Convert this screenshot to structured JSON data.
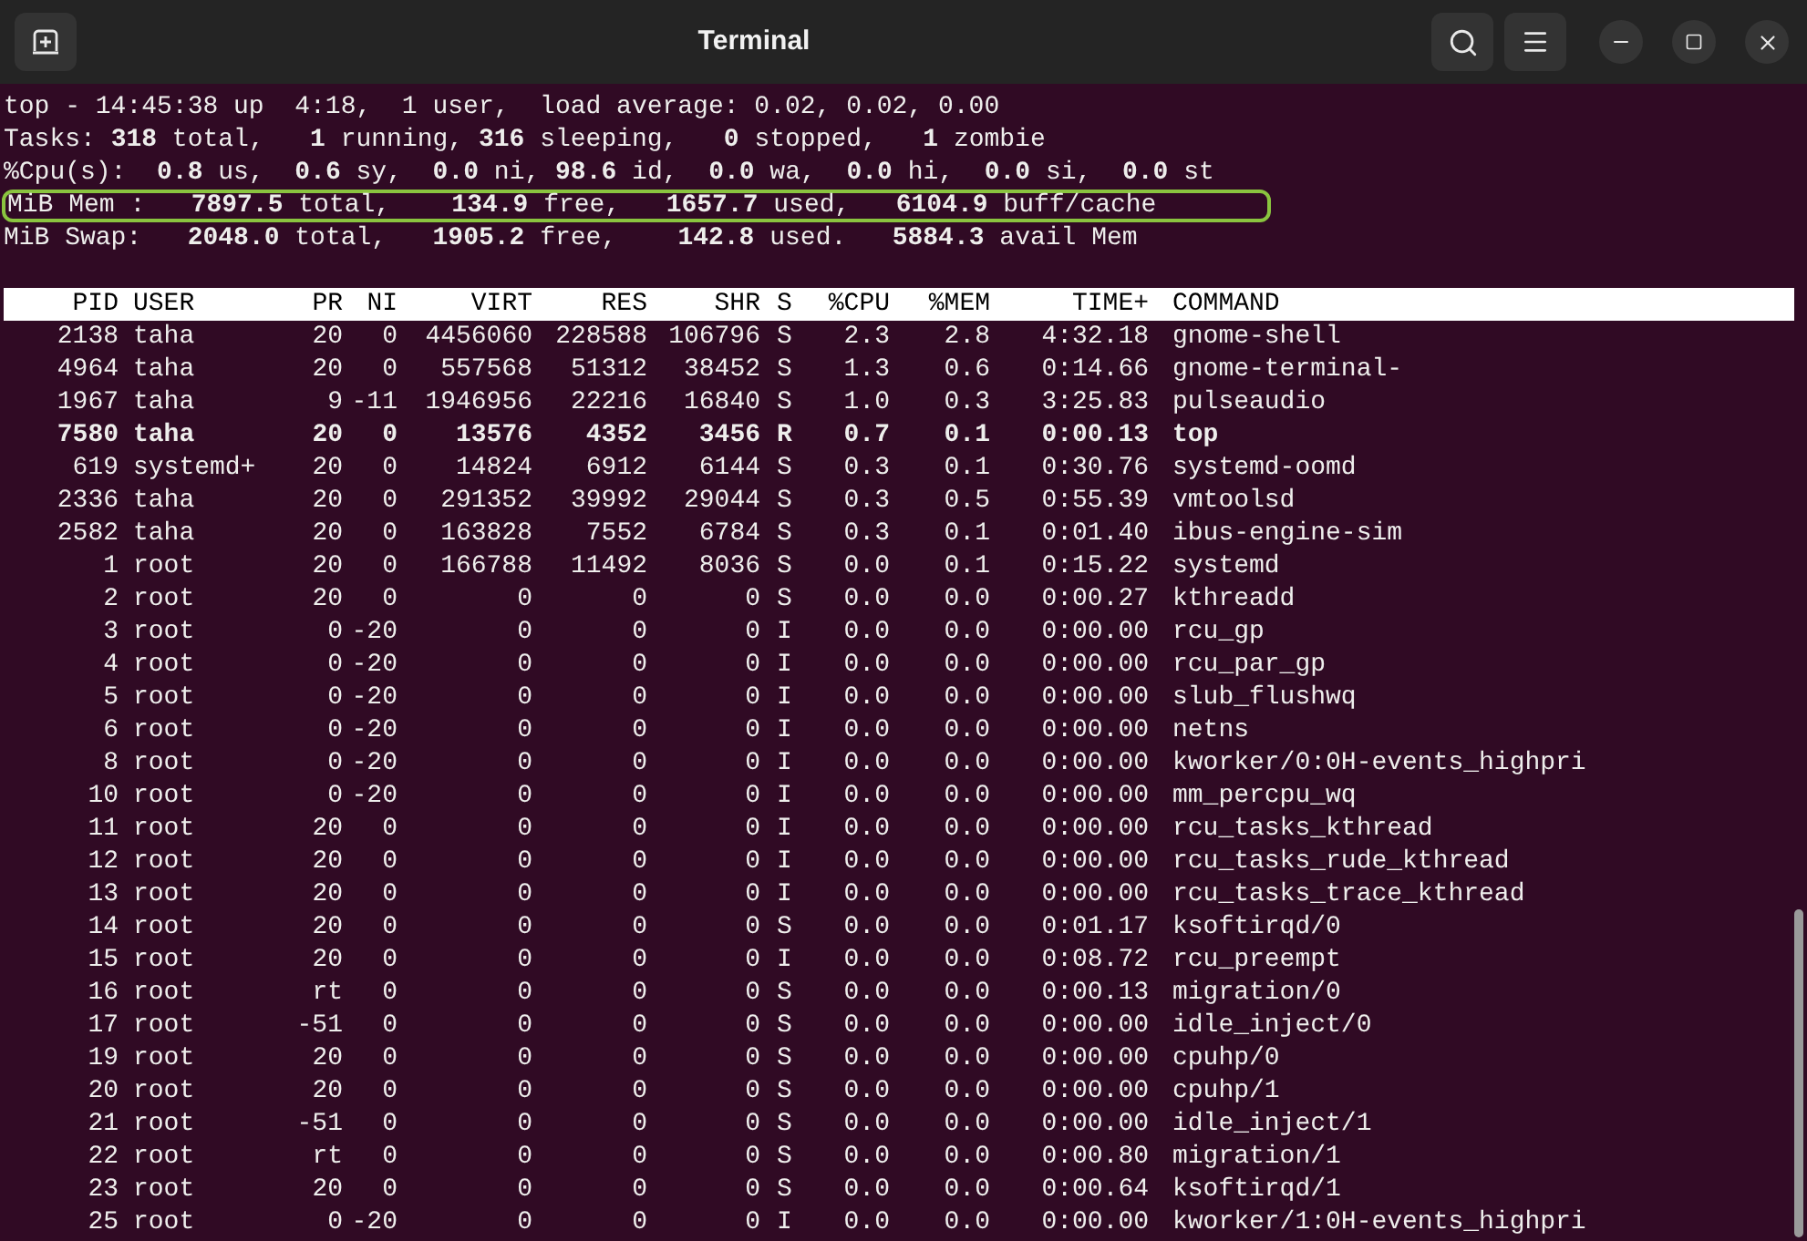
{
  "window": {
    "title": "Terminal"
  },
  "summary": [
    {
      "text": "top - 14:45:38 up  4:18,  1 user,  load average: 0.02, 0.02, 0.00",
      "highlighted": false
    },
    {
      "text": "Tasks: **318** total,   **1** running, **316** sleeping,   **0** stopped,   **1** zombie",
      "highlighted": false
    },
    {
      "text": "%Cpu(s):  **0.8** us,  **0.6** sy,  **0.0** ni, **98.6** id,  **0.0** wa,  **0.0** hi,  **0.0** si,  **0.0** st",
      "highlighted": false
    },
    {
      "text": "MiB Mem :   **7897.5** total,    **134.9** free,   **1657.7** used,   **6104.9** buff/cache",
      "highlighted": true
    },
    {
      "text": "MiB Swap:   **2048.0** total,   **1905.2** free,    **142.8** used.   **5884.3** avail Mem",
      "highlighted": false
    }
  ],
  "table": {
    "columns": [
      "PID",
      "USER",
      "PR",
      "NI",
      "VIRT",
      "RES",
      "SHR",
      "S",
      "%CPU",
      "%MEM",
      "TIME+",
      "COMMAND"
    ],
    "rows": [
      {
        "bold": false,
        "cells": [
          "2138",
          "taha",
          "20",
          "0",
          "4456060",
          "228588",
          "106796",
          "S",
          "2.3",
          "2.8",
          "4:32.18",
          "gnome-shell"
        ]
      },
      {
        "bold": false,
        "cells": [
          "4964",
          "taha",
          "20",
          "0",
          "557568",
          "51312",
          "38452",
          "S",
          "1.3",
          "0.6",
          "0:14.66",
          "gnome-terminal-"
        ]
      },
      {
        "bold": false,
        "cells": [
          "1967",
          "taha",
          "9",
          "-11",
          "1946956",
          "22216",
          "16840",
          "S",
          "1.0",
          "0.3",
          "3:25.83",
          "pulseaudio"
        ]
      },
      {
        "bold": true,
        "cells": [
          "7580",
          "taha",
          "20",
          "0",
          "13576",
          "4352",
          "3456",
          "R",
          "0.7",
          "0.1",
          "0:00.13",
          "top"
        ]
      },
      {
        "bold": false,
        "cells": [
          "619",
          "systemd+",
          "20",
          "0",
          "14824",
          "6912",
          "6144",
          "S",
          "0.3",
          "0.1",
          "0:30.76",
          "systemd-oomd"
        ]
      },
      {
        "bold": false,
        "cells": [
          "2336",
          "taha",
          "20",
          "0",
          "291352",
          "39992",
          "29044",
          "S",
          "0.3",
          "0.5",
          "0:55.39",
          "vmtoolsd"
        ]
      },
      {
        "bold": false,
        "cells": [
          "2582",
          "taha",
          "20",
          "0",
          "163828",
          "7552",
          "6784",
          "S",
          "0.3",
          "0.1",
          "0:01.40",
          "ibus-engine-sim"
        ]
      },
      {
        "bold": false,
        "cells": [
          "1",
          "root",
          "20",
          "0",
          "166788",
          "11492",
          "8036",
          "S",
          "0.0",
          "0.1",
          "0:15.22",
          "systemd"
        ]
      },
      {
        "bold": false,
        "cells": [
          "2",
          "root",
          "20",
          "0",
          "0",
          "0",
          "0",
          "S",
          "0.0",
          "0.0",
          "0:00.27",
          "kthreadd"
        ]
      },
      {
        "bold": false,
        "cells": [
          "3",
          "root",
          "0",
          "-20",
          "0",
          "0",
          "0",
          "I",
          "0.0",
          "0.0",
          "0:00.00",
          "rcu_gp"
        ]
      },
      {
        "bold": false,
        "cells": [
          "4",
          "root",
          "0",
          "-20",
          "0",
          "0",
          "0",
          "I",
          "0.0",
          "0.0",
          "0:00.00",
          "rcu_par_gp"
        ]
      },
      {
        "bold": false,
        "cells": [
          "5",
          "root",
          "0",
          "-20",
          "0",
          "0",
          "0",
          "I",
          "0.0",
          "0.0",
          "0:00.00",
          "slub_flushwq"
        ]
      },
      {
        "bold": false,
        "cells": [
          "6",
          "root",
          "0",
          "-20",
          "0",
          "0",
          "0",
          "I",
          "0.0",
          "0.0",
          "0:00.00",
          "netns"
        ]
      },
      {
        "bold": false,
        "cells": [
          "8",
          "root",
          "0",
          "-20",
          "0",
          "0",
          "0",
          "I",
          "0.0",
          "0.0",
          "0:00.00",
          "kworker/0:0H-events_highpri"
        ]
      },
      {
        "bold": false,
        "cells": [
          "10",
          "root",
          "0",
          "-20",
          "0",
          "0",
          "0",
          "I",
          "0.0",
          "0.0",
          "0:00.00",
          "mm_percpu_wq"
        ]
      },
      {
        "bold": false,
        "cells": [
          "11",
          "root",
          "20",
          "0",
          "0",
          "0",
          "0",
          "I",
          "0.0",
          "0.0",
          "0:00.00",
          "rcu_tasks_kthread"
        ]
      },
      {
        "bold": false,
        "cells": [
          "12",
          "root",
          "20",
          "0",
          "0",
          "0",
          "0",
          "I",
          "0.0",
          "0.0",
          "0:00.00",
          "rcu_tasks_rude_kthread"
        ]
      },
      {
        "bold": false,
        "cells": [
          "13",
          "root",
          "20",
          "0",
          "0",
          "0",
          "0",
          "I",
          "0.0",
          "0.0",
          "0:00.00",
          "rcu_tasks_trace_kthread"
        ]
      },
      {
        "bold": false,
        "cells": [
          "14",
          "root",
          "20",
          "0",
          "0",
          "0",
          "0",
          "S",
          "0.0",
          "0.0",
          "0:01.17",
          "ksoftirqd/0"
        ]
      },
      {
        "bold": false,
        "cells": [
          "15",
          "root",
          "20",
          "0",
          "0",
          "0",
          "0",
          "I",
          "0.0",
          "0.0",
          "0:08.72",
          "rcu_preempt"
        ]
      },
      {
        "bold": false,
        "cells": [
          "16",
          "root",
          "rt",
          "0",
          "0",
          "0",
          "0",
          "S",
          "0.0",
          "0.0",
          "0:00.13",
          "migration/0"
        ]
      },
      {
        "bold": false,
        "cells": [
          "17",
          "root",
          "-51",
          "0",
          "0",
          "0",
          "0",
          "S",
          "0.0",
          "0.0",
          "0:00.00",
          "idle_inject/0"
        ]
      },
      {
        "bold": false,
        "cells": [
          "19",
          "root",
          "20",
          "0",
          "0",
          "0",
          "0",
          "S",
          "0.0",
          "0.0",
          "0:00.00",
          "cpuhp/0"
        ]
      },
      {
        "bold": false,
        "cells": [
          "20",
          "root",
          "20",
          "0",
          "0",
          "0",
          "0",
          "S",
          "0.0",
          "0.0",
          "0:00.00",
          "cpuhp/1"
        ]
      },
      {
        "bold": false,
        "cells": [
          "21",
          "root",
          "-51",
          "0",
          "0",
          "0",
          "0",
          "S",
          "0.0",
          "0.0",
          "0:00.00",
          "idle_inject/1"
        ]
      },
      {
        "bold": false,
        "cells": [
          "22",
          "root",
          "rt",
          "0",
          "0",
          "0",
          "0",
          "S",
          "0.0",
          "0.0",
          "0:00.80",
          "migration/1"
        ]
      },
      {
        "bold": false,
        "cells": [
          "23",
          "root",
          "20",
          "0",
          "0",
          "0",
          "0",
          "S",
          "0.0",
          "0.0",
          "0:00.64",
          "ksoftirqd/1"
        ]
      },
      {
        "bold": false,
        "cells": [
          "25",
          "root",
          "0",
          "-20",
          "0",
          "0",
          "0",
          "I",
          "0.0",
          "0.0",
          "0:00.00",
          "kworker/1:0H-events_highpri"
        ]
      }
    ]
  }
}
